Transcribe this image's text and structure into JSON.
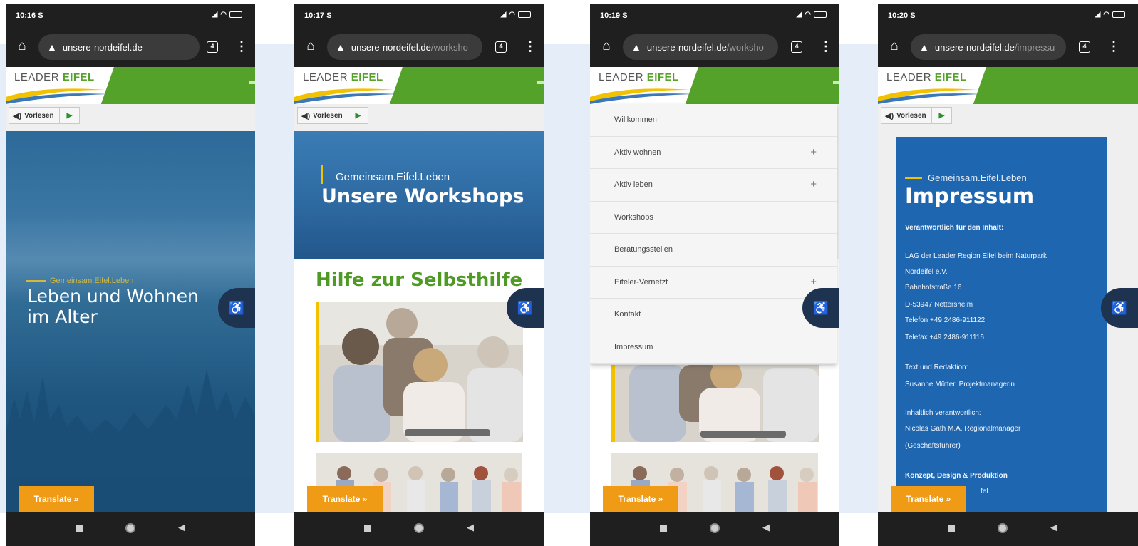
{
  "colors": {
    "background_band": "#e4edf8",
    "header_green": "#55a22a",
    "hero_blue": "#2d6a99",
    "accent_yellow": "#f2c200",
    "translate_orange": "#f09b16",
    "accessibility_navy": "#1e3350",
    "impressum_blue": "#1f66b0"
  },
  "phones": [
    {
      "time": "10:16",
      "status_s": "S",
      "url_host": "unsere-nordeifel.de",
      "url_path": "",
      "tab_count": "4",
      "logo_leader": "LEADER",
      "logo_eifel": "EIFEL",
      "listen_label": "Vorlesen",
      "hero_kicker": "Gemeinsam.Eifel.Leben",
      "hero_title_line1": "Leben und Wohnen",
      "hero_title_line2": "im Alter",
      "translate_label": "Translate »"
    },
    {
      "time": "10:17",
      "status_s": "S",
      "url_host": "unsere-nordeifel.de",
      "url_path": "/worksho",
      "tab_count": "4",
      "logo_leader": "LEADER",
      "logo_eifel": "EIFEL",
      "listen_label": "Vorlesen",
      "hero_kicker": "Gemeinsam.Eifel.Leben",
      "hero_title": "Unsere Workshops",
      "section_heading": "Hilfe zur Selbsthilfe",
      "translate_label": "Translate »"
    },
    {
      "time": "10:19",
      "status_s": "S",
      "url_host": "unsere-nordeifel.de",
      "url_path": "/worksho",
      "tab_count": "4",
      "logo_leader": "LEADER",
      "logo_eifel": "EIFEL",
      "menu": [
        {
          "label": "Willkommen",
          "expandable": false
        },
        {
          "label": "Aktiv wohnen",
          "expandable": true
        },
        {
          "label": "Aktiv leben",
          "expandable": true
        },
        {
          "label": "Workshops",
          "expandable": false
        },
        {
          "label": "Beratungsstellen",
          "expandable": false
        },
        {
          "label": "Eifeler-Vernetzt",
          "expandable": true
        },
        {
          "label": "Kontakt",
          "expandable": false
        },
        {
          "label": "Impressum",
          "expandable": false
        }
      ],
      "menu_plus": "+",
      "translate_label": "Translate »"
    },
    {
      "time": "10:20",
      "status_s": "S",
      "url_host": "unsere-nordeifel.de",
      "url_path": "/impressu",
      "tab_count": "4",
      "logo_leader": "LEADER",
      "logo_eifel": "EIFEL",
      "listen_label": "Vorlesen",
      "hero_kicker": "Gemeinsam.Eifel.Leben",
      "hero_title": "Impressum",
      "lines": {
        "responsible_heading": "Verantwortlich für den Inhalt:",
        "org_line1": "LAG der Leader Region Eifel beim Naturpark",
        "org_line2": "Nordeifel e.V.",
        "street": "Bahnhofstraße 16",
        "city": "D-53947 Nettersheim",
        "phone": "Telefon +49 2486-911122",
        "fax": "Telefax +49 2486-911116",
        "text_heading": "Text und Redaktion:",
        "text_person": "Susanne Mütter, Projektmanagerin",
        "content_heading": "Inhaltlich verantwortlich:",
        "content_person": "Nicolas Gath M.A. Regionalmanager",
        "content_role": "(Geschäftsführer)",
        "concept_heading": "Konzept, Design & Produktion",
        "concept_partial": "fel"
      },
      "translate_label": "Translate »"
    }
  ],
  "icons": [
    "home-icon",
    "warning-icon",
    "tabs-icon",
    "menu-dots-icon",
    "speaker-icon",
    "play-icon",
    "accessibility-icon",
    "nav-recents-icon",
    "nav-home-icon",
    "nav-back-icon",
    "signal-icon",
    "wifi-icon",
    "battery-icon"
  ]
}
